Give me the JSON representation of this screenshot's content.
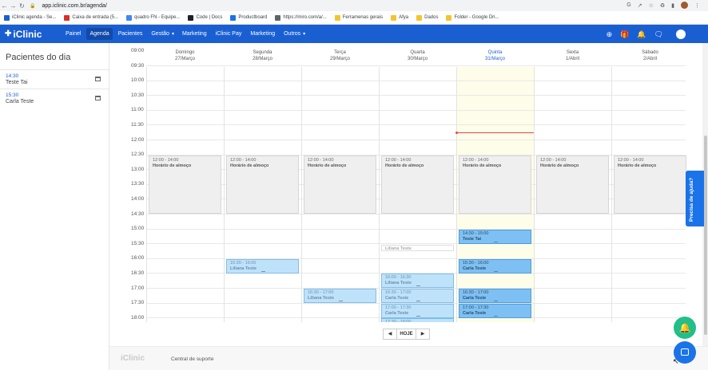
{
  "browser": {
    "url": "app.iclinic.com.br/agenda/",
    "bookmarks": [
      {
        "label": "iClinic agenda - Se...",
        "color": "#1a5fd2"
      },
      {
        "label": "Caixa de entrada (5...",
        "color": "#d93025"
      },
      {
        "label": "quadro FN - Equipe...",
        "color": "#4285f4"
      },
      {
        "label": "Code | Docs",
        "color": "#202124"
      },
      {
        "label": "Productboard",
        "color": "#1a73e8"
      },
      {
        "label": "https://miro.com/a/...",
        "color": "#5f6368"
      },
      {
        "label": "Ferramenas gerais",
        "color": "#f4c430"
      },
      {
        "label": "Afya",
        "color": "#f4c430"
      },
      {
        "label": "Dados",
        "color": "#f4c430"
      },
      {
        "label": "Folder - Google Dri...",
        "color": "#f4c430"
      }
    ]
  },
  "app": {
    "logo": "iClinic",
    "brand_color": "#1a5fd2",
    "nav": [
      "Painel",
      "Agenda",
      "Pacientes",
      "Gestão",
      "Marketing",
      "iClinic Pay",
      "Marketing",
      "Outros"
    ],
    "active_nav": "Agenda"
  },
  "sidebar": {
    "title": "Pacientes do dia",
    "patients": [
      {
        "time": "14:30",
        "name": "Teste Tai"
      },
      {
        "time": "15:30",
        "name": "Carla Teste"
      }
    ]
  },
  "calendar": {
    "times": [
      "09:00",
      "09:30",
      "10:00",
      "10:30",
      "11:00",
      "11:30",
      "12:00",
      "12:30",
      "13:00",
      "13:30",
      "14:00",
      "14:30",
      "15:00",
      "15:30",
      "16:00",
      "16:30",
      "17:00",
      "17:30",
      "18:00"
    ],
    "days": [
      {
        "name": "Domingo",
        "date": "27/Março"
      },
      {
        "name": "Segunda",
        "date": "28/Março"
      },
      {
        "name": "Terça",
        "date": "29/Março"
      },
      {
        "name": "Quarta",
        "date": "30/Março"
      },
      {
        "name": "Quinta",
        "date": "31/Março",
        "today": true
      },
      {
        "name": "Sexta",
        "date": "1/Abril"
      },
      {
        "name": "Sábado",
        "date": "2/Abril"
      }
    ],
    "lunch": {
      "time": "12:00 - 14:00",
      "label": "Horário de almoço"
    },
    "appointments": [
      {
        "day": 1,
        "time": "15:30 - 16:00",
        "name": "Liliana Teste",
        "style": "light"
      },
      {
        "day": 2,
        "time": "16:30 - 17:00",
        "name": "Liliana Teste",
        "style": "light"
      },
      {
        "day": 3,
        "time": "",
        "name": "Liliana Teste",
        "style": "faded"
      },
      {
        "day": 3,
        "time": "16:00 - 16:30",
        "name": "Liliana Teste",
        "style": "light"
      },
      {
        "day": 3,
        "time": "16:30 - 17:00",
        "name": "Carla Teste",
        "style": "light"
      },
      {
        "day": 3,
        "time": "17:00 - 17:30",
        "name": "Carla Teste",
        "style": "light"
      },
      {
        "day": 3,
        "time": "17:30 - 18:00",
        "name": "Edir Teste",
        "style": "light"
      },
      {
        "day": 4,
        "time": "14:30 - 15:00",
        "name": "Teste Tai",
        "style": "strong"
      },
      {
        "day": 4,
        "time": "15:30 - 16:00",
        "name": "Carla Teste",
        "style": "strong"
      },
      {
        "day": 4,
        "time": "16:30 - 17:00",
        "name": "Carla Teste",
        "style": "strong"
      },
      {
        "day": 4,
        "time": "17:00 - 17:30",
        "name": "Carla Teste",
        "style": "strong"
      }
    ],
    "pager_today": "HOJE"
  },
  "footer": {
    "logo": "iClinic",
    "support_link": "Central de suporte"
  },
  "help": {
    "label": "Precisa de ajuda?"
  }
}
